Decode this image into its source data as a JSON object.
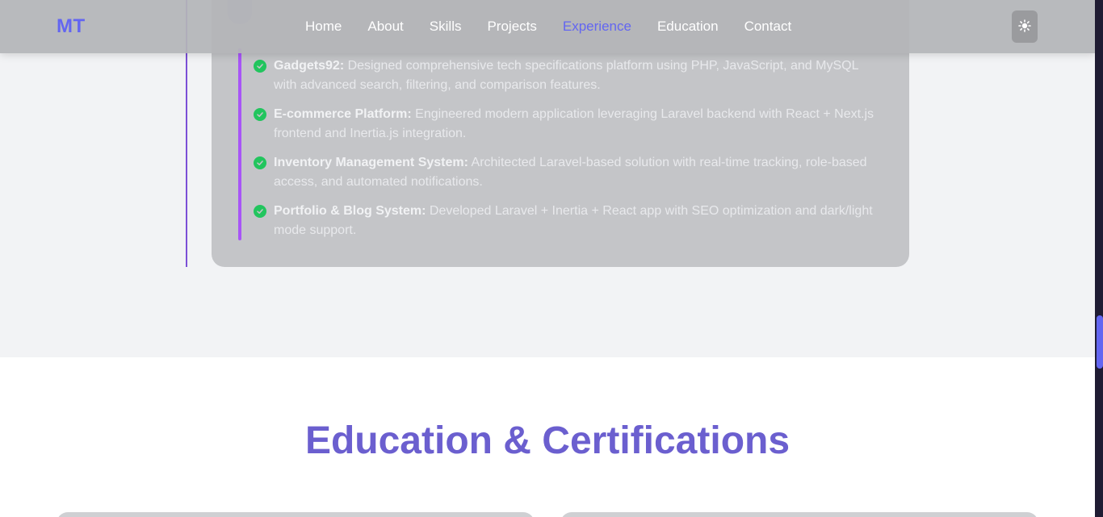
{
  "nav": {
    "logo": "MT",
    "links": [
      "Home",
      "About",
      "Skills",
      "Projects",
      "Experience",
      "Education",
      "Contact"
    ],
    "active": "Experience",
    "theme_toggle_icon": "sun-icon"
  },
  "experience": {
    "achievements": [
      {
        "title": "Gadgets92:",
        "text": " Designed comprehensive tech specifications platform using PHP, JavaScript, and MySQL with advanced search, filtering, and comparison features."
      },
      {
        "title": "E-commerce Platform:",
        "text": " Engineered modern application leveraging Laravel backend with React + Next.js frontend and Inertia.js integration."
      },
      {
        "title": "Inventory Management System:",
        "text": " Architected Laravel-based solution with real-time tracking, role-based access, and automated notifications."
      },
      {
        "title": "Portfolio & Blog System:",
        "text": " Developed Laravel + Inertia + React app with SEO optimization and dark/light mode support."
      }
    ]
  },
  "education": {
    "title": "Education & Certifications"
  },
  "colors": {
    "accent": "#6366f1",
    "timeline": "#a855f7",
    "check": "#22c55e"
  }
}
